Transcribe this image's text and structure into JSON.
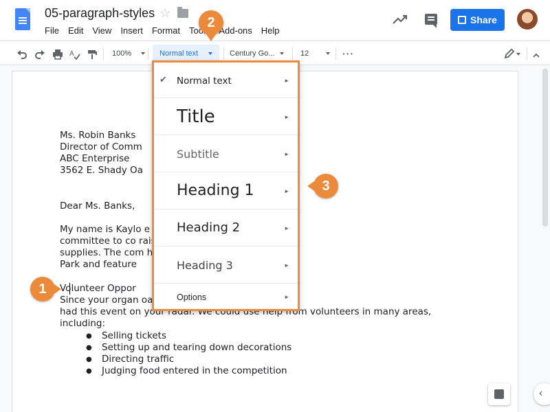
{
  "header": {
    "doc_title": "05-paragraph-styles",
    "share_label": "Share",
    "menu": [
      "File",
      "Edit",
      "View",
      "Insert",
      "Format",
      "Tools",
      "Add-ons",
      "Help"
    ]
  },
  "toolbar": {
    "zoom": "100%",
    "paragraph_style": "Normal text",
    "font": "Century Go...",
    "font_size": "12"
  },
  "document": {
    "address": [
      "Ms. Robin Banks",
      "Director of Comm",
      "ABC Enterprise",
      "3562 E. Shady Oa"
    ],
    "salutation": "Dear Ms. Banks,",
    "para1": [
      "My name is Kaylo                                          e school district’s event",
      "committee to co                                           raise money for classroom",
      "supplies. The com                                         his summer at Highland Grove",
      "Park and feature"
    ],
    "heading_line": "Volunteer Oppor",
    "para2": [
      "Since your organ                                          oast, I wanted to make sure you",
      "had this event on your radar. We could use help from volunteers in many areas,",
      "including:"
    ],
    "bullets": [
      "Selling tickets",
      "Setting up and tearing down decorations",
      "Directing traffic",
      "Judging food entered in the competition"
    ]
  },
  "dropdown": {
    "items": [
      "Normal text",
      "Title",
      "Subtitle",
      "Heading 1",
      "Heading 2",
      "Heading 3",
      "Options"
    ],
    "checked": "Normal text",
    "check_glyph": "✔",
    "arrow_glyph": "►"
  },
  "callouts": [
    "1",
    "2",
    "3"
  ],
  "colors": {
    "accent_orange": "#ec8a3c",
    "share_blue": "#1a73e8",
    "style_selected_bg": "#e8f0fe"
  }
}
